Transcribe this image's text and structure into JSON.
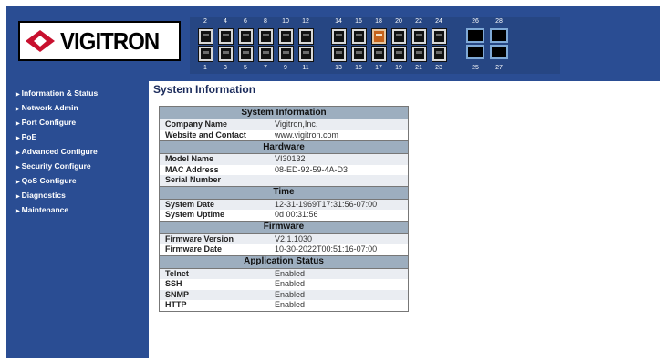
{
  "brand": {
    "name": "VIGITRON"
  },
  "ports": {
    "top_numbers": [
      "2",
      "4",
      "6",
      "8",
      "10",
      "12",
      "14",
      "16",
      "18",
      "20",
      "22",
      "24",
      "26",
      "28"
    ],
    "bottom_numbers": [
      "1",
      "3",
      "5",
      "7",
      "9",
      "11",
      "13",
      "15",
      "17",
      "19",
      "21",
      "23",
      "25",
      "27"
    ],
    "active_port": "18"
  },
  "sidebar": {
    "items": [
      {
        "label": "Information & Status"
      },
      {
        "label": "Network Admin"
      },
      {
        "label": "Port Configure"
      },
      {
        "label": "PoE"
      },
      {
        "label": "Advanced Configure"
      },
      {
        "label": "Security Configure"
      },
      {
        "label": "QoS Configure"
      },
      {
        "label": "Diagnostics"
      },
      {
        "label": "Maintenance"
      }
    ]
  },
  "page": {
    "title": "System Information"
  },
  "sections": [
    {
      "title": "System Information",
      "rows": [
        {
          "label": "Company Name",
          "value": "Vigitron,Inc."
        },
        {
          "label": "Website and Contact",
          "value": "www.vigitron.com"
        }
      ]
    },
    {
      "title": "Hardware",
      "rows": [
        {
          "label": "Model Name",
          "value": "VI30132"
        },
        {
          "label": "MAC Address",
          "value": "08-ED-92-59-4A-D3"
        },
        {
          "label": "Serial Number",
          "value": ""
        }
      ]
    },
    {
      "title": "Time",
      "rows": [
        {
          "label": "System Date",
          "value": "12-31-1969T17:31:56-07:00"
        },
        {
          "label": "System Uptime",
          "value": "0d 00:31:56"
        }
      ]
    },
    {
      "title": "Firmware",
      "rows": [
        {
          "label": "Firmware Version",
          "value": "V2.1.1030"
        },
        {
          "label": "Firmware Date",
          "value": "10-30-2022T00:51:16-07:00"
        }
      ]
    },
    {
      "title": "Application Status",
      "rows": [
        {
          "label": "Telnet",
          "value": "Enabled"
        },
        {
          "label": "SSH",
          "value": "Enabled"
        },
        {
          "label": "SNMP",
          "value": "Enabled"
        },
        {
          "label": "HTTP",
          "value": "Enabled"
        }
      ]
    }
  ]
}
